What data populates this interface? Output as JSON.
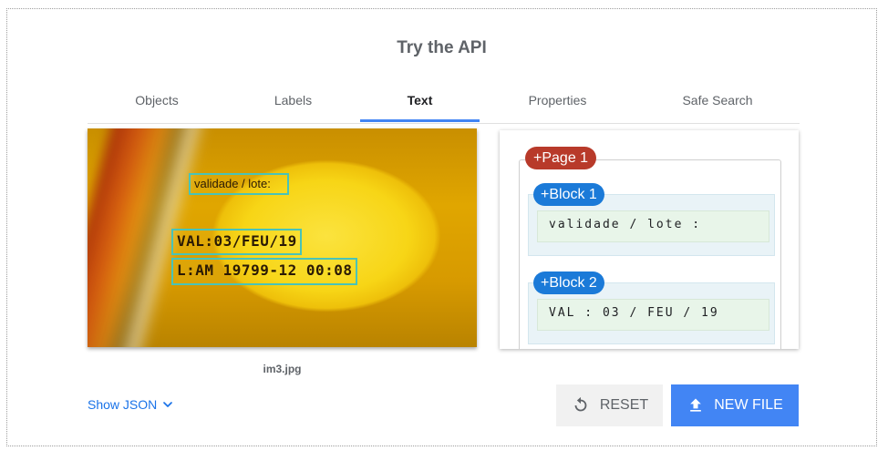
{
  "title": "Try the API",
  "tabs": [
    {
      "label": "Objects",
      "active": false
    },
    {
      "label": "Labels",
      "active": false
    },
    {
      "label": "Text",
      "active": true
    },
    {
      "label": "Properties",
      "active": false
    },
    {
      "label": "Safe Search",
      "active": false
    }
  ],
  "image": {
    "filename": "im3.jpg",
    "detections": [
      "validade / lote:",
      "VAL:03/FEU/19",
      "L:AM 19799-12 00:08"
    ]
  },
  "result": {
    "page_label": "+Page 1",
    "blocks": [
      {
        "label": "+Block 1",
        "text": "validade / lote :"
      },
      {
        "label": "+Block 2",
        "text": "VAL : 03 / FEU / 19"
      }
    ]
  },
  "actions": {
    "show_json": "Show JSON",
    "reset": "RESET",
    "new_file": "NEW FILE"
  },
  "colors": {
    "accent": "#4285f4",
    "page_badge": "#b83a2a",
    "block_badge": "#1b7ad8",
    "bbox": "#49c3b8"
  }
}
